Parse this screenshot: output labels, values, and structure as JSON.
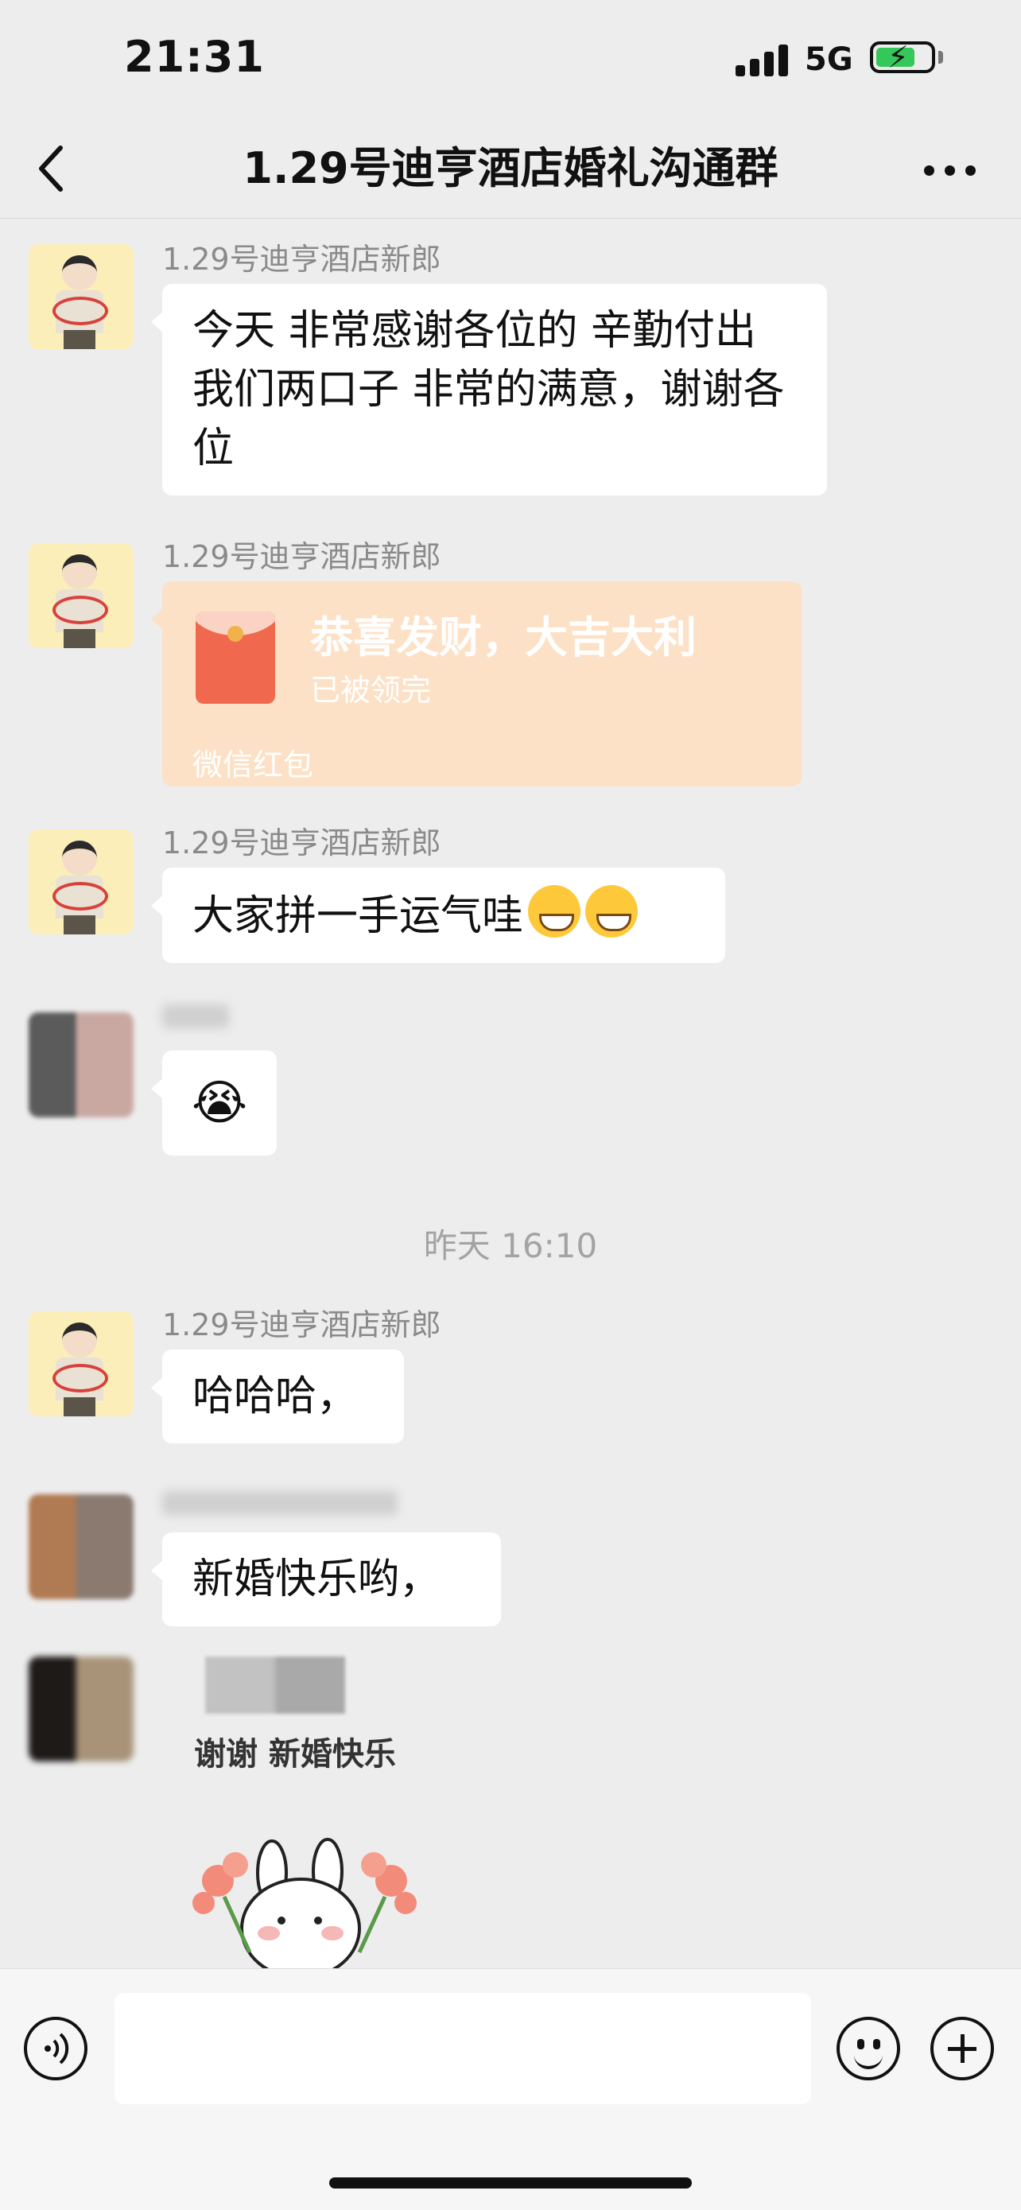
{
  "status_bar": {
    "time": "21:31",
    "network": "5G"
  },
  "nav": {
    "title": "1.29号迪亨酒店婚礼沟通群"
  },
  "messages": [
    {
      "sender": "1.29号迪亨酒店新郎",
      "text": "今天 非常感谢各位的 辛勤付出 我们两口子 非常的满意，谢谢各位"
    },
    {
      "sender": "1.29号迪亨酒店新郎",
      "red_packet": {
        "title": "恭喜发财，大吉大利",
        "status": "已被领完",
        "footer": "微信红包"
      }
    },
    {
      "sender": "1.29号迪亨酒店新郎",
      "text": "大家拼一手运气哇"
    },
    {
      "sender": "",
      "emoji": "😭"
    },
    {
      "sender": "1.29号迪亨酒店新郎",
      "text": "哈哈哈，"
    },
    {
      "sender": "",
      "text": "新婚快乐哟，"
    },
    {
      "sender": "",
      "sticker_caption": "谢谢 新婚快乐"
    }
  ],
  "time_divider": "昨天 16:10",
  "input": {
    "placeholder": ""
  },
  "colors": {
    "background": "#ededed",
    "bubble": "#ffffff",
    "red_packet": "#fde1c6",
    "red_packet_icon": "#f0694f"
  },
  "icons": [
    "back-icon",
    "more-icon",
    "voice-icon",
    "emoji-icon",
    "plus-icon"
  ]
}
